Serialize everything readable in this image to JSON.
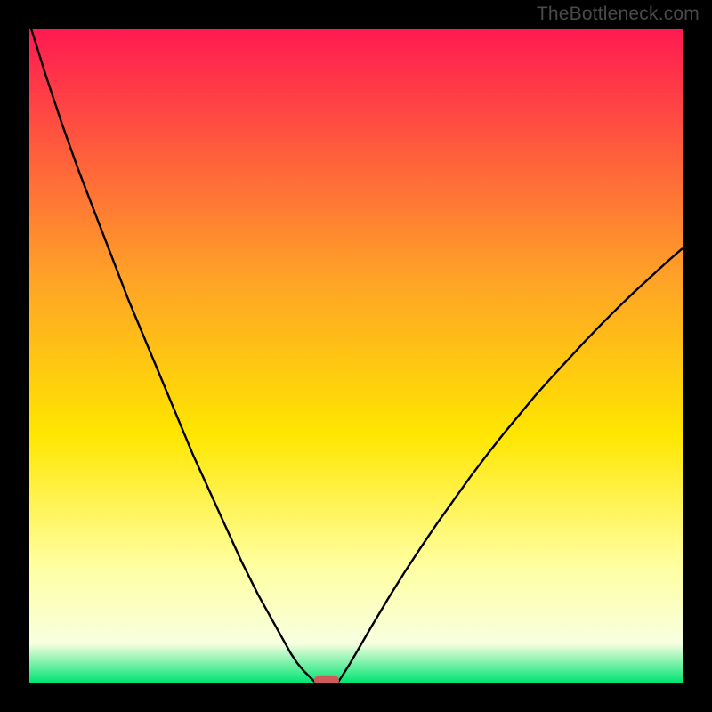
{
  "watermark": "TheBottleneck.com",
  "colors": {
    "gradient_top": "#ff1a51",
    "gradient_upper_mid": "#ffa227",
    "gradient_mid": "#ffe600",
    "gradient_lower_mid": "#ffffa0",
    "gradient_near_bottom": "#f8ffe0",
    "gradient_bottom": "#00e472",
    "curve": "#000000",
    "marker_fill": "#cf5a5a",
    "frame": "#000000"
  },
  "chart_data": {
    "type": "line",
    "title": "",
    "xlabel": "",
    "ylabel": "",
    "xlim": [
      0,
      100
    ],
    "ylim": [
      0,
      100
    ],
    "series": [
      {
        "name": "left-curve",
        "x": [
          0,
          2.5,
          5,
          7.5,
          10,
          12.5,
          15,
          17.5,
          20,
          22.5,
          25,
          27.5,
          30,
          32.5,
          35,
          37.5,
          40,
          41,
          42,
          43,
          43.8
        ],
        "values": [
          101,
          93,
          85.5,
          78.5,
          72,
          65.5,
          59,
          53,
          47,
          41,
          35,
          29.5,
          24,
          18.5,
          13.5,
          9,
          4.5,
          3,
          1.8,
          0.8,
          0
        ]
      },
      {
        "name": "right-curve",
        "x": [
          47.2,
          48,
          49,
          50,
          52.5,
          55,
          57.5,
          60,
          62.5,
          65,
          67.5,
          70,
          72.5,
          75,
          77.5,
          80,
          82.5,
          85,
          87.5,
          90,
          92.5,
          95,
          97.5,
          100
        ],
        "values": [
          0,
          1.2,
          2.8,
          4.5,
          8.8,
          13,
          17,
          20.8,
          24.5,
          28,
          31.5,
          34.8,
          38,
          41,
          44,
          46.8,
          49.5,
          52.2,
          54.8,
          57.3,
          59.7,
          62,
          64.3,
          66.5
        ]
      }
    ],
    "marker": {
      "name": "bottleneck-marker",
      "x_center": 45.5,
      "x_half_width": 1.9,
      "y": 0.3
    }
  }
}
